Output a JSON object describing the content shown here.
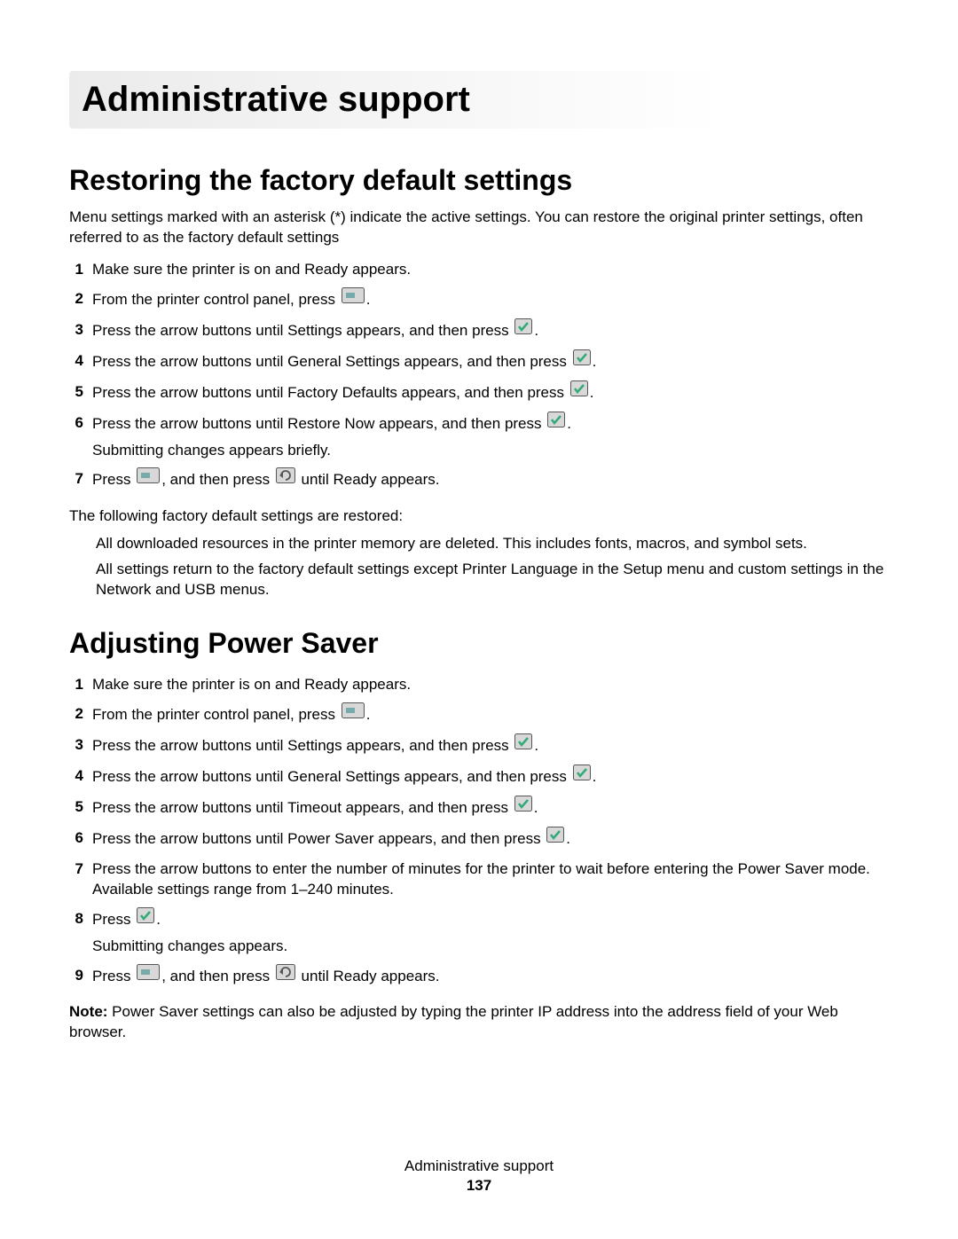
{
  "chapter_title": "Administrative support",
  "section1": {
    "heading": "Restoring the factory default settings",
    "intro": "Menu settings marked with an asterisk (*) indicate the active settings. You can restore the original printer settings, often referred to as the factory default settings",
    "steps": [
      {
        "num": "1",
        "text_a": "Make sure the printer is on and ",
        "term": "Ready",
        "text_b": " appears."
      },
      {
        "num": "2",
        "text_a": "From the printer control panel, press ",
        "icon": "menu",
        "text_b": "."
      },
      {
        "num": "3",
        "text_a": "Press the arrow buttons until ",
        "term": "Settings",
        "mid": " appears, and then press ",
        "icon": "check",
        "text_b": "."
      },
      {
        "num": "4",
        "text_a": "Press the arrow buttons until ",
        "term": "General Settings",
        "mid": " appears, and then press ",
        "icon": "check",
        "text_b": "."
      },
      {
        "num": "5",
        "text_a": "Press the arrow buttons until ",
        "term": "Factory Defaults",
        "mid": " appears, and then press ",
        "icon": "check",
        "text_b": "."
      },
      {
        "num": "6",
        "text_a": "Press the arrow buttons until ",
        "term": "Restore Now",
        "mid": " appears, and then press ",
        "icon": "check",
        "text_b": ".",
        "sub_term": "Submitting changes",
        "sub_text": " appears briefly."
      },
      {
        "num": "7",
        "text_a": "Press ",
        "icon1": "menu",
        "text_mid": ", and then press ",
        "icon2": "back",
        "text_b": " until ",
        "term": "Ready",
        "text_c": " appears."
      }
    ],
    "after": "The following factory default settings are restored:",
    "bullets": [
      {
        "text": "All downloaded resources in the printer memory are deleted. This includes fonts, macros, and symbol sets."
      },
      {
        "text_a": "All settings return to the factory default settings except ",
        "term": "Printer Language",
        "text_b": " in the Setup menu and custom settings in the Network and USB menus."
      }
    ]
  },
  "section2": {
    "heading": "Adjusting Power Saver",
    "steps": [
      {
        "num": "1",
        "text_a": "Make sure the printer is on and ",
        "term": "Ready",
        "text_b": " appears."
      },
      {
        "num": "2",
        "text_a": "From the printer control panel, press ",
        "icon": "menu",
        "text_b": "."
      },
      {
        "num": "3",
        "text_a": "Press the arrow buttons until ",
        "term": "Settings",
        "mid": " appears, and then press ",
        "icon": "check",
        "text_b": "."
      },
      {
        "num": "4",
        "text_a": "Press the arrow buttons until ",
        "term": "General Settings",
        "mid": " appears, and then press ",
        "icon": "check",
        "text_b": "."
      },
      {
        "num": "5",
        "text_a": "Press the arrow buttons until ",
        "term": "Timeout",
        "mid": " appears, and then press ",
        "icon": "check",
        "text_b": "."
      },
      {
        "num": "6",
        "text_a": "Press the arrow buttons until ",
        "term": "Power Saver",
        "mid": " appears, and then press ",
        "icon": "check",
        "text_b": "."
      },
      {
        "num": "7",
        "text_a": "Press the arrow buttons to enter the number of minutes for the printer to wait before entering the Power Saver mode. Available settings range from 1–240 minutes."
      },
      {
        "num": "8",
        "text_a": "Press ",
        "icon": "check",
        "text_b": ".",
        "sub_term": "Submitting changes",
        "sub_text": " appears."
      },
      {
        "num": "9",
        "text_a": "Press ",
        "icon1": "menu",
        "text_mid": ", and then press ",
        "icon2": "back",
        "text_b": " until ",
        "term": "Ready",
        "text_c": " appears."
      }
    ],
    "note_lead": "Note: ",
    "note_text": "Power Saver settings can also be adjusted by typing the printer IP address into the address field of your Web browser."
  },
  "footer": {
    "title": "Administrative support",
    "page": "137"
  }
}
